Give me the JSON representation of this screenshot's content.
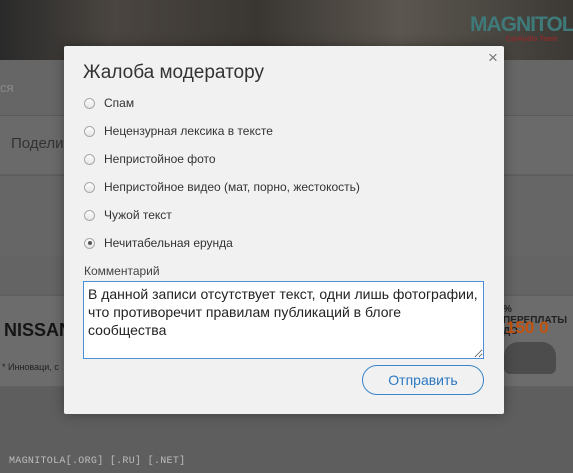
{
  "background": {
    "logo_main": "MAGNITOLA",
    "logo_sub": "CarAudio Team",
    "search_placeholder_fragment": "ся",
    "share_fragment": "Поделит",
    "ad": {
      "brand": "NISSAN",
      "footnote": "* Инноваци, с",
      "promo": "% ПЕРЕПЛАТЫ\nДО",
      "price": "150 0"
    },
    "footer": "MAGNITOLA[.ORG] [.RU] [.NET]"
  },
  "modal": {
    "title": "Жалоба модератору",
    "close_glyph": "×",
    "options": [
      {
        "label": "Спам",
        "checked": false
      },
      {
        "label": "Нецензурная лексика в тексте",
        "checked": false
      },
      {
        "label": "Непристойное фото",
        "checked": false
      },
      {
        "label": "Непристойное видео (мат, порно, жестокость)",
        "checked": false
      },
      {
        "label": "Чужой текст",
        "checked": false
      },
      {
        "label": "Нечитабельная ерунда",
        "checked": true
      }
    ],
    "comment_label": "Комментарий",
    "comment_value": "В данной записи отсутствует текст, одни лишь фотографии, что противоречит правилам публикаций в блоге сообщества",
    "submit_label": "Отправить"
  },
  "colors": {
    "accent": "#2a78c2",
    "input_border": "#4a90d9",
    "overlay": "#5f5f5f",
    "modal_bg": "#f1f1f1"
  }
}
